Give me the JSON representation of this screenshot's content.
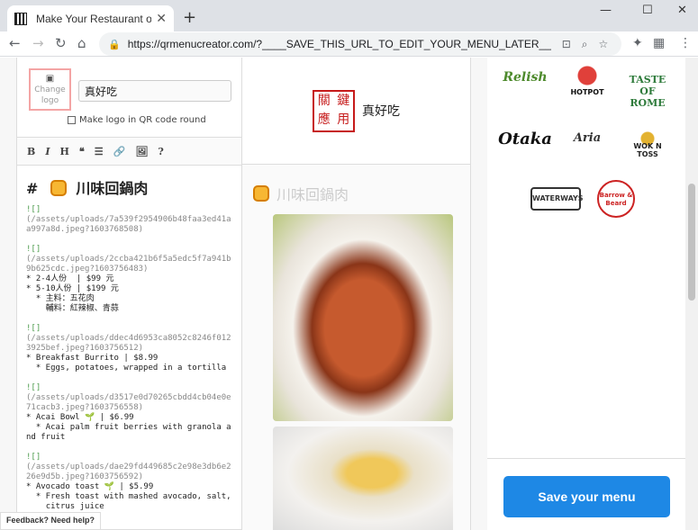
{
  "browser": {
    "tab_title": "Make Your Restaurant or Bar M",
    "url": "https://qrmenucreator.com/?____SAVE_THIS_URL_TO_EDIT_YOUR_MENU_LATER____&acti..."
  },
  "editor": {
    "change_logo_label": "Change logo",
    "restaurant_name": "真好吃",
    "round_logo_label": "Make logo in QR code round",
    "toolbar_buttons": [
      "B",
      "I",
      "H",
      "❝",
      "☰",
      "🔗",
      "🖼",
      "?"
    ],
    "heading": "川味回鍋肉",
    "blocks": [
      {
        "img": "![]",
        "path": "(/assets/uploads/7a539f2954906b48faa3ed41aa997a8d.jpeg?1603768508)",
        "lines": []
      },
      {
        "img": "![]",
        "path": "(/assets/uploads/2ccba421b6f5a5edc5f7a941b9b625cdc.jpeg?1603756483)",
        "lines": [
          "* 2-4人份  | $99 元",
          "* 5-10人份 | $199 元",
          "  * 主料：五花肉",
          "    輔料：紅辣椒、青蒜"
        ]
      },
      {
        "img": "![]",
        "path": "(/assets/uploads/ddec4d6953ca8052c8246f0123925bef.jpeg?1603756512)",
        "lines": [
          "* Breakfast Burrito | $8.99",
          "  * Eggs, potatoes, wrapped in a tortilla"
        ]
      },
      {
        "img": "![]",
        "path": "(/assets/uploads/d3517e0d70265cbdd4cb04e0e71cacb3.jpeg?1603756558)",
        "lines": [
          "* Acai Bowl 🌱 | $6.99",
          "  * Acai palm fruit berries with granola and fruit"
        ]
      },
      {
        "img": "![]",
        "path": "(/assets/uploads/dae29fd449685c2e98e3db6e226e9d5b.jpeg?1603756592)",
        "lines": [
          "* Avocado toast 🌱 | $5.99",
          "  * Fresh toast with mashed avocado, salt,",
          "    citrus juice"
        ]
      }
    ]
  },
  "preview": {
    "seal_chars": [
      "鍵",
      "用",
      "關",
      "應"
    ],
    "name": "真好吃",
    "heading": "川味回鍋肉"
  },
  "sidebar": {
    "brands": [
      "Relish",
      "HOTPOT",
      "TASTE OF ROME",
      "Otaka",
      "Aria",
      "WOK N TOSS",
      "WATERWAYS",
      "Barrow & Beard"
    ],
    "save_label": "Save your menu"
  },
  "feedback_label": "Feedback? Need help?"
}
